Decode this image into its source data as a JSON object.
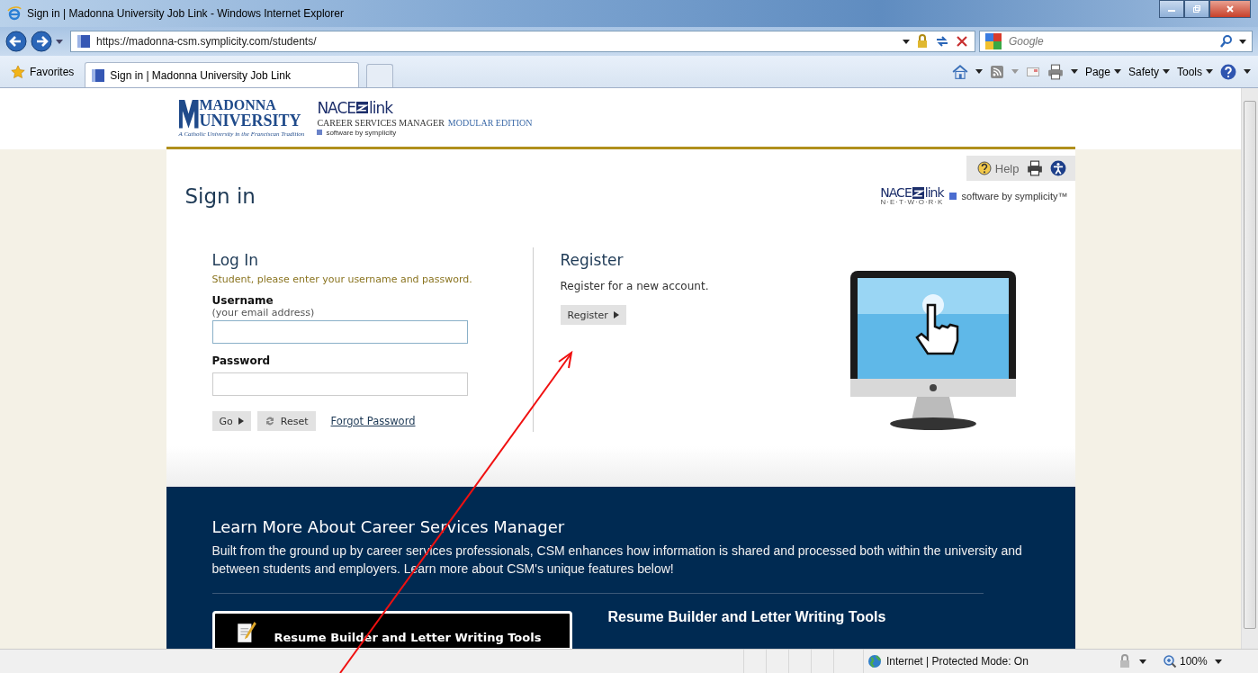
{
  "window": {
    "title": "Sign in | Madonna University Job Link - Windows Internet Explorer"
  },
  "address_bar": {
    "url": "https://madonna-csm.symplicity.com/students/"
  },
  "search": {
    "placeholder": "Google"
  },
  "favorites": {
    "label": "Favorites"
  },
  "tabs": [
    {
      "label": "Sign in | Madonna University Job Link",
      "selected": true
    }
  ],
  "command_bar": {
    "menus": [
      "Page",
      "Safety",
      "Tools"
    ]
  },
  "header": {
    "university_logo": {
      "line1": "MADONNA",
      "line2": "UNIVERSITY",
      "tagline": "A Catholic University in the Franciscan Tradition"
    },
    "product_logo": {
      "brand_left": "NACE",
      "brand_right": "link",
      "product": "CAREER SERVICES MANAGER",
      "edition": "MODULAR EDITION",
      "vendor": "software by symplicity"
    }
  },
  "page": {
    "title": "Sign in",
    "help": "Help",
    "network_logo": {
      "brand_left": "NACE",
      "brand_right": "link",
      "subtitle": "N·E·T·W·O·R·K"
    },
    "vendor": "software by symplicity™"
  },
  "login": {
    "heading": "Log In",
    "instruction": "Student, please enter your username and password.",
    "username_label": "Username",
    "username_hint": "(your email address)",
    "password_label": "Password",
    "go": "Go",
    "reset": "Reset",
    "forgot": "Forgot Password"
  },
  "register": {
    "heading": "Register",
    "text": "Register for a new account.",
    "button": "Register"
  },
  "learn_more": {
    "heading": "Learn More About Career Services Manager",
    "text": "Built from the ground up by career services professionals, CSM enhances how information is shared and processed both within the university and between students and employers. Learn more about CSM's unique features below!",
    "feature_tab": "Resume Builder and Letter Writing Tools",
    "feature_heading": "Resume Builder and Letter Writing Tools"
  },
  "status_bar": {
    "zone": "Internet | Protected Mode: On",
    "zoom": "100%"
  }
}
